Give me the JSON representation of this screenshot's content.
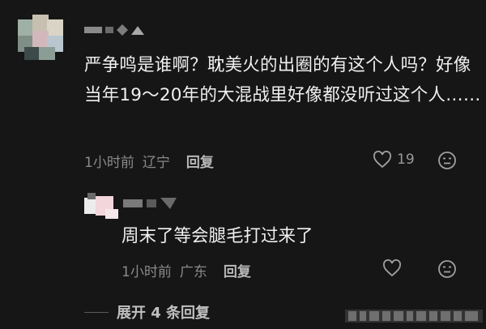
{
  "comment": {
    "avatar_icon": "pixelated-avatar-icon",
    "text": "严争鸣是谁啊？耽美火的出圈的有这个人吗？好像当年19～20年的大混战里好像都没听过这个人……",
    "time": "1小时前",
    "location": "辽宁",
    "reply_label": "回复",
    "like_count": "19",
    "like_icon": "heart-icon",
    "dislike_icon": "dislike-face-icon"
  },
  "reply": {
    "avatar_icon": "pixelated-avatar-icon",
    "text": "周末了等会腿毛打过来了",
    "time": "1小时前",
    "location": "广东",
    "reply_label": "回复",
    "like_icon": "heart-icon",
    "dislike_icon": "dislike-face-icon"
  },
  "expand_replies": {
    "label": "展开 4 条回复",
    "count": 4
  },
  "colors": {
    "background": "#161616",
    "text": "#f0f0f0",
    "meta": "#8a8a8a"
  }
}
